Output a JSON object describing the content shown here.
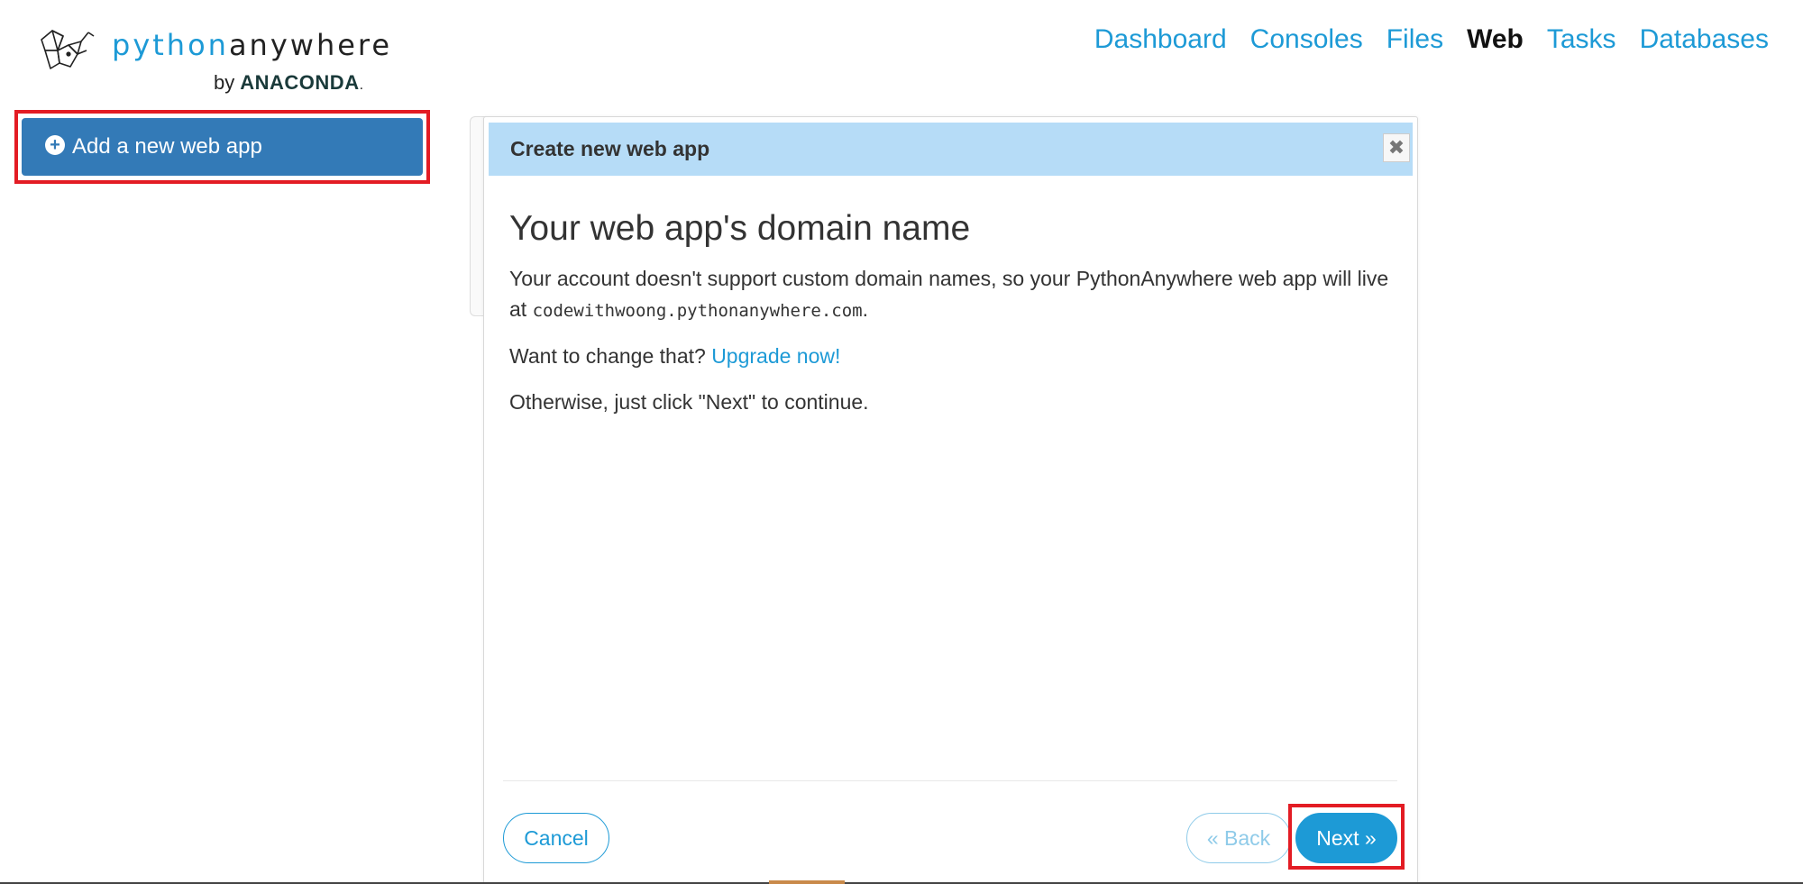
{
  "logo": {
    "word_part1": "python",
    "word_part2": "anywhere",
    "by_text": "by",
    "brand": "ANACONDA",
    "brand_suffix": "."
  },
  "nav": {
    "items": [
      {
        "label": "Dashboard",
        "active": false
      },
      {
        "label": "Consoles",
        "active": false
      },
      {
        "label": "Files",
        "active": false
      },
      {
        "label": "Web",
        "active": true
      },
      {
        "label": "Tasks",
        "active": false
      },
      {
        "label": "Databases",
        "active": false
      }
    ]
  },
  "sidebar": {
    "add_button_label": "Add a new web app",
    "add_button_icon": "plus-circle-icon"
  },
  "modal": {
    "title": "Create new web app",
    "close_icon": "close-icon",
    "heading": "Your web app's domain name",
    "para1_text": "Your account doesn't support custom domain names, so your PythonAnywhere web app will live at ",
    "domain": "codewithwoong.pythonanywhere.com",
    "para1_end": ".",
    "para2_text": "Want to change that? ",
    "upgrade_link": "Upgrade now!",
    "para3_text": "Otherwise, just click \"Next\" to continue.",
    "cancel_label": "Cancel",
    "back_label": "« Back",
    "next_label": "Next »"
  },
  "colors": {
    "accent": "#1d9ad6",
    "primary_button": "#337ab7",
    "modal_header": "#b6dcf7",
    "highlight": "#e31c24"
  }
}
